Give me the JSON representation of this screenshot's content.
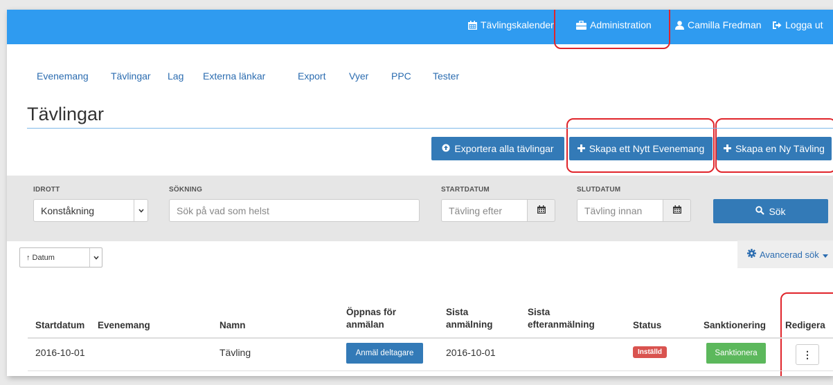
{
  "topnav": {
    "calendar": "Tävlingskalender",
    "admin": "Administration",
    "user": "Camilla Fredman",
    "logout": "Logga ut"
  },
  "subnav": [
    "Evenemang",
    "Tävlingar",
    "Lag",
    "Externa länkar",
    "Export",
    "Vyer",
    "PPC",
    "Tester"
  ],
  "page_title": "Tävlingar",
  "actions": {
    "export_all": "Exportera alla tävlingar",
    "create_event": "Skapa ett Nytt Evenemang",
    "create_competition": "Skapa en Ny Tävling"
  },
  "search": {
    "sport_label": "IDROTT",
    "sport_value": "Konståkning",
    "query_label": "SÖKNING",
    "query_placeholder": "Sök på vad som helst",
    "start_label": "STARTDATUM",
    "start_placeholder": "Tävling efter",
    "end_label": "SLUTDATUM",
    "end_placeholder": "Tävling innan",
    "search_button": "Sök"
  },
  "sort": {
    "value": "↑ Datum"
  },
  "advanced_search": "Avancerad sök",
  "table": {
    "headers": [
      "Startdatum",
      "Evenemang",
      "Namn",
      "Öppnas för anmälan",
      "Sista anmälning",
      "Sista efteranmälning",
      "Status",
      "Sanktionering",
      "Redigera"
    ],
    "rows": [
      {
        "startdatum": "2016-10-01",
        "evenemang": "",
        "namn": "Tävling",
        "open_button": "Anmäl deltagare",
        "sista_anmalning": "2016-10-01",
        "sista_efteranmalning": "",
        "status": "Inställd",
        "sanction_button": "Sanktionera",
        "edit": "⋮"
      }
    ]
  },
  "colors": {
    "topbar": "#2f9bf0",
    "primary": "#337ab7",
    "danger": "#d9534f",
    "success": "#5cb85c",
    "highlight": "#e0242a"
  }
}
